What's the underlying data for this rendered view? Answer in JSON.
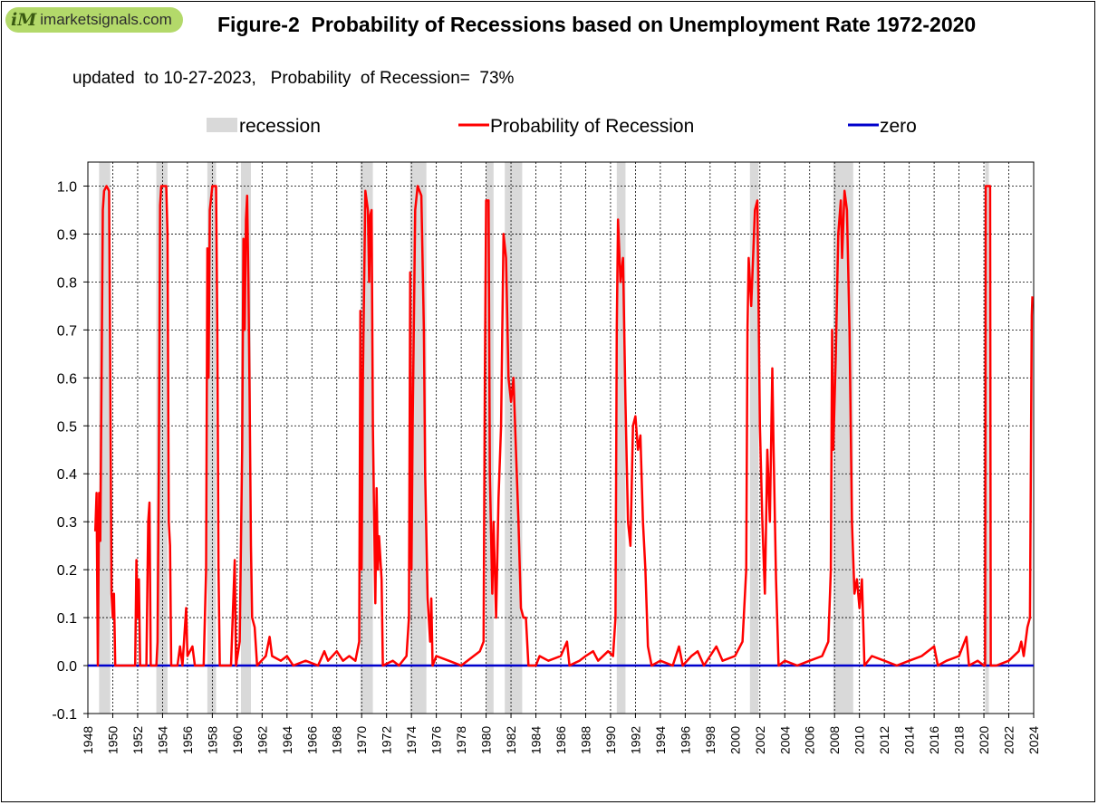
{
  "logo": {
    "mark": "iM",
    "text": "imarketsignals.com"
  },
  "title": "Figure-2  Probability of Recessions based on Unemployment Rate 1972-2020",
  "subtitle": "updated  to 10-27-2023,   Probability  of Recession=  73%",
  "colors": {
    "recession": "#d9d9d9",
    "probability": "#ff0000",
    "zero": "#0000cc",
    "grid": "#000000"
  },
  "chart_data": {
    "type": "line",
    "xlim": [
      1948,
      2024
    ],
    "ylim": [
      -0.1,
      1.05
    ],
    "x_ticks": [
      1948,
      1950,
      1952,
      1954,
      1956,
      1958,
      1960,
      1962,
      1964,
      1966,
      1968,
      1970,
      1972,
      1974,
      1976,
      1978,
      1980,
      1982,
      1984,
      1986,
      1988,
      1990,
      1992,
      1994,
      1996,
      1998,
      2000,
      2002,
      2004,
      2006,
      2008,
      2010,
      2012,
      2014,
      2016,
      2018,
      2020,
      2022,
      2024
    ],
    "y_ticks": [
      "-0.1",
      "0.0",
      "0.1",
      "0.2",
      "0.3",
      "0.4",
      "0.5",
      "0.6",
      "0.7",
      "0.8",
      "0.9",
      "1.0"
    ],
    "y_tick_values": [
      -0.1,
      0,
      0.1,
      0.2,
      0.3,
      0.4,
      0.5,
      0.6,
      0.7,
      0.8,
      0.9,
      1.0
    ],
    "legend": [
      {
        "label": "recession",
        "kind": "box"
      },
      {
        "label": "Probability of Recession",
        "kind": "line"
      },
      {
        "label": "zero",
        "kind": "line"
      }
    ],
    "recessions": [
      [
        1948.9,
        1949.8
      ],
      [
        1953.5,
        1954.4
      ],
      [
        1957.6,
        1958.3
      ],
      [
        1960.3,
        1961.1
      ],
      [
        1969.9,
        1970.9
      ],
      [
        1973.9,
        1975.2
      ],
      [
        1980.0,
        1980.6
      ],
      [
        1981.5,
        1982.9
      ],
      [
        1990.5,
        1991.2
      ],
      [
        2001.2,
        2001.9
      ],
      [
        2007.9,
        2009.5
      ],
      [
        2020.1,
        2020.4
      ]
    ],
    "series": [
      {
        "name": "Probability of Recession",
        "points": [
          [
            1948.6,
            0.28
          ],
          [
            1948.7,
            0.36
          ],
          [
            1948.8,
            0.0
          ],
          [
            1948.9,
            0.36
          ],
          [
            1949.0,
            0.26
          ],
          [
            1949.1,
            0.6
          ],
          [
            1949.2,
            0.95
          ],
          [
            1949.3,
            0.99
          ],
          [
            1949.5,
            1.0
          ],
          [
            1949.7,
            0.99
          ],
          [
            1949.8,
            0.6
          ],
          [
            1949.9,
            0.15
          ],
          [
            1950.0,
            0.1
          ],
          [
            1950.1,
            0.15
          ],
          [
            1950.2,
            0.0
          ],
          [
            1950.8,
            0.0
          ],
          [
            1951.5,
            0.0
          ],
          [
            1951.8,
            0.0
          ],
          [
            1951.9,
            0.22
          ],
          [
            1952.0,
            0.1
          ],
          [
            1952.1,
            0.18
          ],
          [
            1952.2,
            0.0
          ],
          [
            1952.7,
            0.0
          ],
          [
            1952.85,
            0.3
          ],
          [
            1952.95,
            0.34
          ],
          [
            1953.05,
            0.0
          ],
          [
            1953.5,
            0.0
          ],
          [
            1953.6,
            0.05
          ],
          [
            1953.7,
            0.4
          ],
          [
            1953.8,
            0.96
          ],
          [
            1953.9,
            1.0
          ],
          [
            1954.3,
            1.0
          ],
          [
            1954.4,
            0.9
          ],
          [
            1954.5,
            0.3
          ],
          [
            1954.6,
            0.25
          ],
          [
            1954.7,
            0.0
          ],
          [
            1955.2,
            0.0
          ],
          [
            1955.4,
            0.04
          ],
          [
            1955.6,
            0.0
          ],
          [
            1955.9,
            0.12
          ],
          [
            1956.0,
            0.02
          ],
          [
            1956.4,
            0.04
          ],
          [
            1956.6,
            0.0
          ],
          [
            1957.3,
            0.0
          ],
          [
            1957.5,
            0.2
          ],
          [
            1957.6,
            0.87
          ],
          [
            1957.7,
            0.6
          ],
          [
            1957.8,
            0.95
          ],
          [
            1958.0,
            1.0
          ],
          [
            1958.3,
            1.0
          ],
          [
            1958.4,
            0.7
          ],
          [
            1958.5,
            0.2
          ],
          [
            1958.6,
            0.0
          ],
          [
            1959.5,
            0.0
          ],
          [
            1959.8,
            0.22
          ],
          [
            1959.9,
            0.0
          ],
          [
            1960.2,
            0.05
          ],
          [
            1960.4,
            0.45
          ],
          [
            1960.5,
            0.89
          ],
          [
            1960.6,
            0.7
          ],
          [
            1960.7,
            0.93
          ],
          [
            1960.8,
            0.98
          ],
          [
            1960.9,
            0.8
          ],
          [
            1961.0,
            0.55
          ],
          [
            1961.1,
            0.25
          ],
          [
            1961.2,
            0.1
          ],
          [
            1961.4,
            0.08
          ],
          [
            1961.6,
            0.0
          ],
          [
            1962.3,
            0.02
          ],
          [
            1962.6,
            0.06
          ],
          [
            1962.8,
            0.02
          ],
          [
            1963.5,
            0.01
          ],
          [
            1964.0,
            0.02
          ],
          [
            1964.5,
            0.0
          ],
          [
            1965.5,
            0.01
          ],
          [
            1966.5,
            0.0
          ],
          [
            1967.0,
            0.03
          ],
          [
            1967.3,
            0.01
          ],
          [
            1968.0,
            0.03
          ],
          [
            1968.5,
            0.01
          ],
          [
            1969.0,
            0.02
          ],
          [
            1969.5,
            0.01
          ],
          [
            1969.8,
            0.05
          ],
          [
            1969.9,
            0.74
          ],
          [
            1970.0,
            0.2
          ],
          [
            1970.1,
            0.6
          ],
          [
            1970.3,
            0.99
          ],
          [
            1970.5,
            0.95
          ],
          [
            1970.6,
            0.8
          ],
          [
            1970.7,
            0.94
          ],
          [
            1970.8,
            0.95
          ],
          [
            1970.9,
            0.5
          ],
          [
            1971.1,
            0.13
          ],
          [
            1971.2,
            0.37
          ],
          [
            1971.3,
            0.2
          ],
          [
            1971.4,
            0.27
          ],
          [
            1971.6,
            0.18
          ],
          [
            1971.7,
            0.0
          ],
          [
            1972.5,
            0.01
          ],
          [
            1973.0,
            0.0
          ],
          [
            1973.6,
            0.02
          ],
          [
            1973.8,
            0.1
          ],
          [
            1973.9,
            0.82
          ],
          [
            1974.0,
            0.2
          ],
          [
            1974.1,
            0.5
          ],
          [
            1974.3,
            0.95
          ],
          [
            1974.5,
            1.0
          ],
          [
            1974.8,
            0.98
          ],
          [
            1975.0,
            0.7
          ],
          [
            1975.1,
            0.4
          ],
          [
            1975.3,
            0.14
          ],
          [
            1975.5,
            0.05
          ],
          [
            1975.6,
            0.14
          ],
          [
            1975.7,
            0.0
          ],
          [
            1976.0,
            0.02
          ],
          [
            1977.0,
            0.01
          ],
          [
            1978.0,
            0.0
          ],
          [
            1979.0,
            0.02
          ],
          [
            1979.5,
            0.03
          ],
          [
            1979.8,
            0.05
          ],
          [
            1979.9,
            0.6
          ],
          [
            1980.0,
            0.97
          ],
          [
            1980.2,
            0.97
          ],
          [
            1980.3,
            0.4
          ],
          [
            1980.5,
            0.15
          ],
          [
            1980.6,
            0.3
          ],
          [
            1980.8,
            0.1
          ],
          [
            1981.0,
            0.35
          ],
          [
            1981.2,
            0.5
          ],
          [
            1981.4,
            0.9
          ],
          [
            1981.6,
            0.85
          ],
          [
            1981.8,
            0.6
          ],
          [
            1982.0,
            0.55
          ],
          [
            1982.2,
            0.6
          ],
          [
            1982.4,
            0.45
          ],
          [
            1982.6,
            0.3
          ],
          [
            1982.8,
            0.12
          ],
          [
            1983.0,
            0.1
          ],
          [
            1983.2,
            0.1
          ],
          [
            1983.4,
            0.0
          ],
          [
            1984.0,
            0.0
          ],
          [
            1984.3,
            0.02
          ],
          [
            1985.0,
            0.01
          ],
          [
            1986.0,
            0.02
          ],
          [
            1986.5,
            0.05
          ],
          [
            1986.7,
            0.0
          ],
          [
            1987.5,
            0.01
          ],
          [
            1988.0,
            0.02
          ],
          [
            1988.6,
            0.03
          ],
          [
            1989.0,
            0.01
          ],
          [
            1989.8,
            0.03
          ],
          [
            1990.2,
            0.02
          ],
          [
            1990.4,
            0.1
          ],
          [
            1990.5,
            0.7
          ],
          [
            1990.6,
            0.93
          ],
          [
            1990.8,
            0.8
          ],
          [
            1991.0,
            0.85
          ],
          [
            1991.2,
            0.55
          ],
          [
            1991.4,
            0.3
          ],
          [
            1991.6,
            0.25
          ],
          [
            1991.8,
            0.5
          ],
          [
            1992.0,
            0.52
          ],
          [
            1992.2,
            0.45
          ],
          [
            1992.4,
            0.48
          ],
          [
            1992.6,
            0.3
          ],
          [
            1992.8,
            0.2
          ],
          [
            1993.0,
            0.04
          ],
          [
            1993.3,
            0.0
          ],
          [
            1994.0,
            0.01
          ],
          [
            1995.0,
            0.0
          ],
          [
            1995.5,
            0.04
          ],
          [
            1995.8,
            0.0
          ],
          [
            1996.5,
            0.02
          ],
          [
            1997.0,
            0.03
          ],
          [
            1997.5,
            0.0
          ],
          [
            1998.0,
            0.02
          ],
          [
            1998.5,
            0.04
          ],
          [
            1999.0,
            0.01
          ],
          [
            2000.0,
            0.02
          ],
          [
            2000.6,
            0.05
          ],
          [
            2000.9,
            0.2
          ],
          [
            2001.0,
            0.7
          ],
          [
            2001.1,
            0.85
          ],
          [
            2001.3,
            0.75
          ],
          [
            2001.6,
            0.95
          ],
          [
            2001.8,
            0.97
          ],
          [
            2002.0,
            0.5
          ],
          [
            2002.2,
            0.3
          ],
          [
            2002.4,
            0.15
          ],
          [
            2002.6,
            0.45
          ],
          [
            2002.8,
            0.3
          ],
          [
            2003.0,
            0.62
          ],
          [
            2003.1,
            0.45
          ],
          [
            2003.3,
            0.18
          ],
          [
            2003.5,
            0.0
          ],
          [
            2004.0,
            0.01
          ],
          [
            2005.0,
            0.0
          ],
          [
            2006.0,
            0.01
          ],
          [
            2007.0,
            0.02
          ],
          [
            2007.5,
            0.05
          ],
          [
            2007.7,
            0.2
          ],
          [
            2007.8,
            0.7
          ],
          [
            2007.9,
            0.45
          ],
          [
            2008.1,
            0.65
          ],
          [
            2008.3,
            0.9
          ],
          [
            2008.5,
            0.97
          ],
          [
            2008.6,
            0.85
          ],
          [
            2008.8,
            0.99
          ],
          [
            2009.0,
            0.95
          ],
          [
            2009.2,
            0.7
          ],
          [
            2009.4,
            0.3
          ],
          [
            2009.6,
            0.15
          ],
          [
            2009.8,
            0.18
          ],
          [
            2010.0,
            0.12
          ],
          [
            2010.2,
            0.18
          ],
          [
            2010.4,
            0.0
          ],
          [
            2011.0,
            0.02
          ],
          [
            2012.0,
            0.01
          ],
          [
            2013.0,
            0.0
          ],
          [
            2014.0,
            0.01
          ],
          [
            2015.0,
            0.02
          ],
          [
            2016.0,
            0.04
          ],
          [
            2016.3,
            0.0
          ],
          [
            2017.0,
            0.01
          ],
          [
            2018.0,
            0.02
          ],
          [
            2018.6,
            0.06
          ],
          [
            2018.8,
            0.0
          ],
          [
            2019.5,
            0.01
          ],
          [
            2020.0,
            0.0
          ],
          [
            2020.1,
            0.0
          ],
          [
            2020.15,
            1.0
          ],
          [
            2020.5,
            1.0
          ],
          [
            2020.55,
            0.0
          ],
          [
            2021.0,
            0.0
          ],
          [
            2022.0,
            0.01
          ],
          [
            2022.8,
            0.03
          ],
          [
            2023.0,
            0.05
          ],
          [
            2023.2,
            0.02
          ],
          [
            2023.5,
            0.08
          ],
          [
            2023.7,
            0.1
          ],
          [
            2023.85,
            0.73
          ],
          [
            2023.9,
            0.77
          ]
        ]
      },
      {
        "name": "zero",
        "points": [
          [
            1948,
            0
          ],
          [
            2024,
            0
          ]
        ]
      }
    ]
  }
}
